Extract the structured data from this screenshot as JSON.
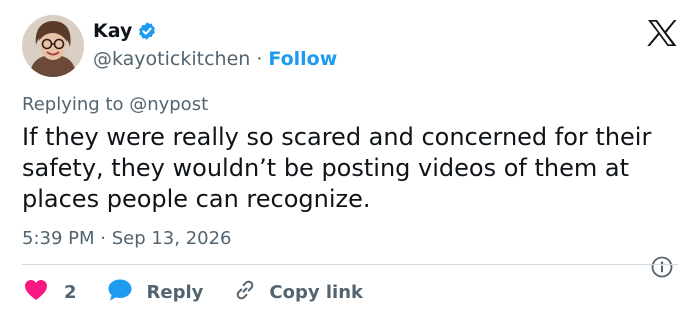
{
  "author": {
    "name": "Kay",
    "handle": "@kayotickitchen",
    "separator": "·",
    "follow_label": "Follow"
  },
  "replying_to": "Replying to @nypost",
  "tweet": {
    "text": "If they were really so scared and concerned for their safety, they wouldn’t be posting videos of them at places people can recognize.",
    "timestamp": "5:39 PM · Sep 13, 2026"
  },
  "actions": {
    "like_count": "2",
    "reply_label": "Reply",
    "copy_link_label": "Copy link"
  },
  "icons": {
    "verified": "verified-badge-icon",
    "brand": "x-logo-icon",
    "info": "info-icon",
    "like": "heart-icon",
    "reply": "speech-bubble-icon",
    "copy": "link-icon"
  },
  "colors": {
    "accent": "#1d9bf0",
    "like": "#f91880",
    "text": "#0f1419",
    "muted": "#536471",
    "divider": "#cfd9de"
  }
}
